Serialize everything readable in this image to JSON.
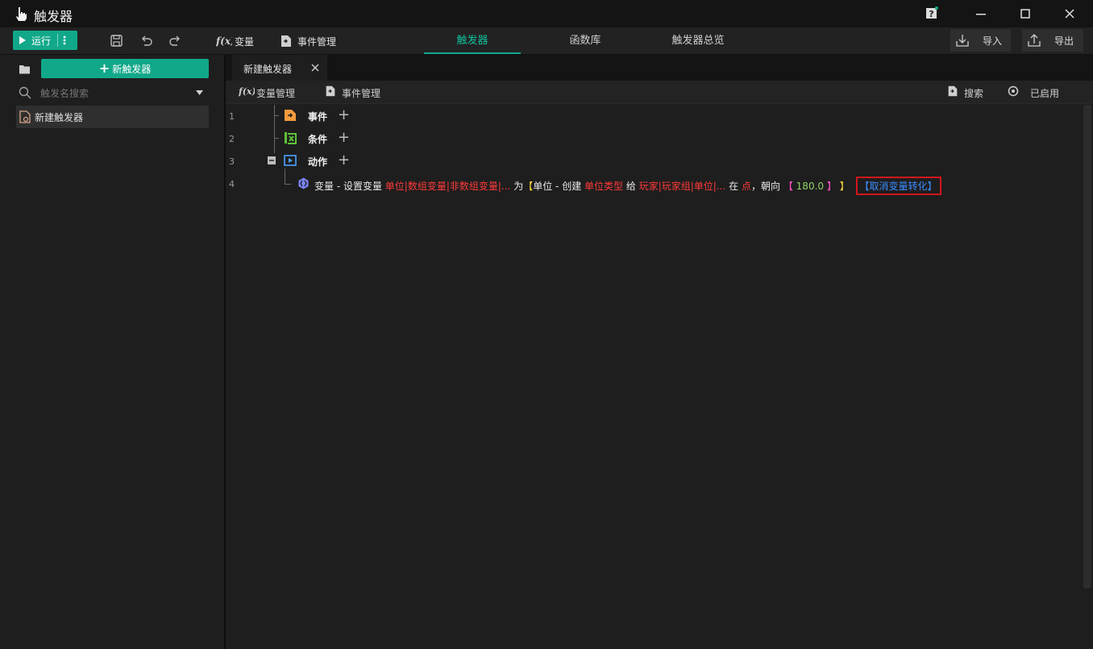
{
  "app": {
    "title": "触发器"
  },
  "toolbar": {
    "run_label": "运行",
    "variable_label": "变量",
    "event_manage_label": "事件管理",
    "tabs": [
      {
        "label": "触发器",
        "active": true
      },
      {
        "label": "函数库",
        "active": false
      },
      {
        "label": "触发器总览",
        "active": false
      }
    ],
    "import_label": "导入",
    "export_label": "导出",
    "accent": "#11a88a"
  },
  "sidebar": {
    "new_trigger_label": "新触发器",
    "search_placeholder": "触发名搜索",
    "items": [
      {
        "label": "新建触发器"
      }
    ]
  },
  "editor": {
    "tab_label": "新建触发器",
    "sub_toolbar": {
      "variable_manage": "变量管理",
      "event_manage": "事件管理",
      "search": "搜索",
      "enabled": "已启用"
    },
    "lines": [
      {
        "num": "1",
        "label": "事件"
      },
      {
        "num": "2",
        "label": "条件"
      },
      {
        "num": "3",
        "label": "动作"
      },
      {
        "num": "4"
      }
    ],
    "action": {
      "prefix": "变量 - 设置变量",
      "var": "单位|数组变量|非数组变量|...",
      "as": "为",
      "bracket_open": "【",
      "unit_create": "单位 - 创建",
      "unit_type": "单位类型",
      "give": "给",
      "player": "玩家|玩家组|单位|...",
      "at": "在",
      "point": "点",
      "facing": "，朝向",
      "angle_open": "【",
      "angle": "180.0",
      "angle_close": "】",
      "bracket_close": "】",
      "convert": "【取消变量转化】"
    }
  }
}
